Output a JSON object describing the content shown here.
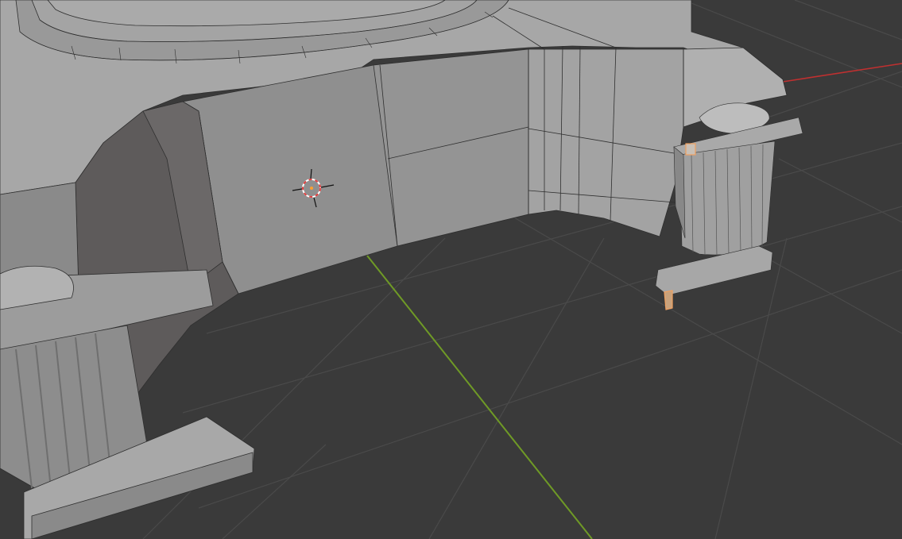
{
  "viewport": {
    "mode": "edit-mode",
    "shading": "solid",
    "background_color": "#3a3a3a",
    "floor_grid_visible": true
  },
  "colors": {
    "grid_line": "#4a4a4a",
    "x_axis": "#c03030",
    "y_axis": "#6f9a26",
    "mesh_light": "#a9a9a9",
    "mesh_mid": "#9a9a9a",
    "mesh_dark": "#7a7a7a",
    "mesh_shadow": "#5e5b5b",
    "wire_edge": "#2f2f2f",
    "selected_edge": "#f0a060",
    "cursor_ring": "#e04040"
  },
  "icons": {
    "cursor": "3d-cursor-icon"
  }
}
